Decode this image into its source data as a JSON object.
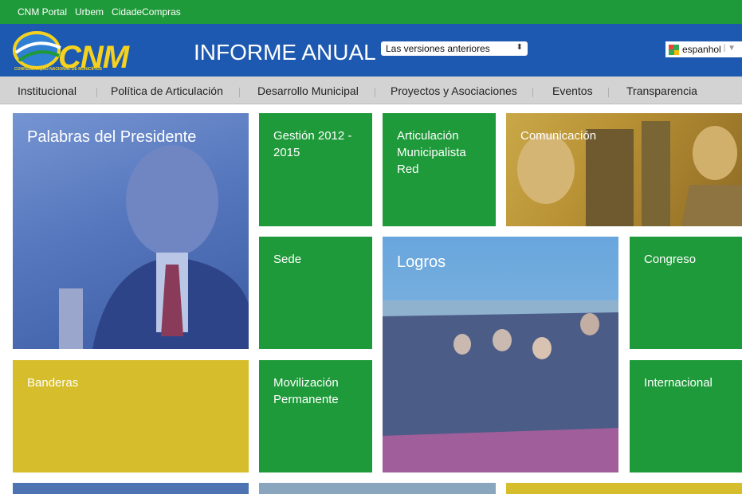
{
  "top_links": [
    "CNM Portal",
    "Urbem",
    "CidadeCompras"
  ],
  "logo": {
    "text": "CNM",
    "subtitle": "CONFEDERAÇÃO NACIONAL DE MUNICÍPIOS"
  },
  "header": {
    "title": "INFORME ANUAL",
    "versions_select": "Las versiones anteriores",
    "language": "espanhol"
  },
  "nav": [
    "Institucional",
    "Política de Articulación",
    "Desarrollo Municipal",
    "Proyectos y Asociaciones",
    "Eventos",
    "Transparencia"
  ],
  "tiles": {
    "presidente": "Palabras del Presidente",
    "gestion": "Gestión 2012 - 2015",
    "articulacion": "Articulación Municipalista Red",
    "comunicacion": "Comunicación",
    "sede": "Sede",
    "logros": "Logros",
    "congreso": "Congreso",
    "banderas": "Banderas",
    "movilizacion": "Movilización Permanente",
    "internacional": "Internacional"
  },
  "colors": {
    "green": "#1f9a3a",
    "blue_header": "#1d59b0",
    "yellow": "#d6bd2b",
    "nav_gray": "#d3d3d3"
  }
}
